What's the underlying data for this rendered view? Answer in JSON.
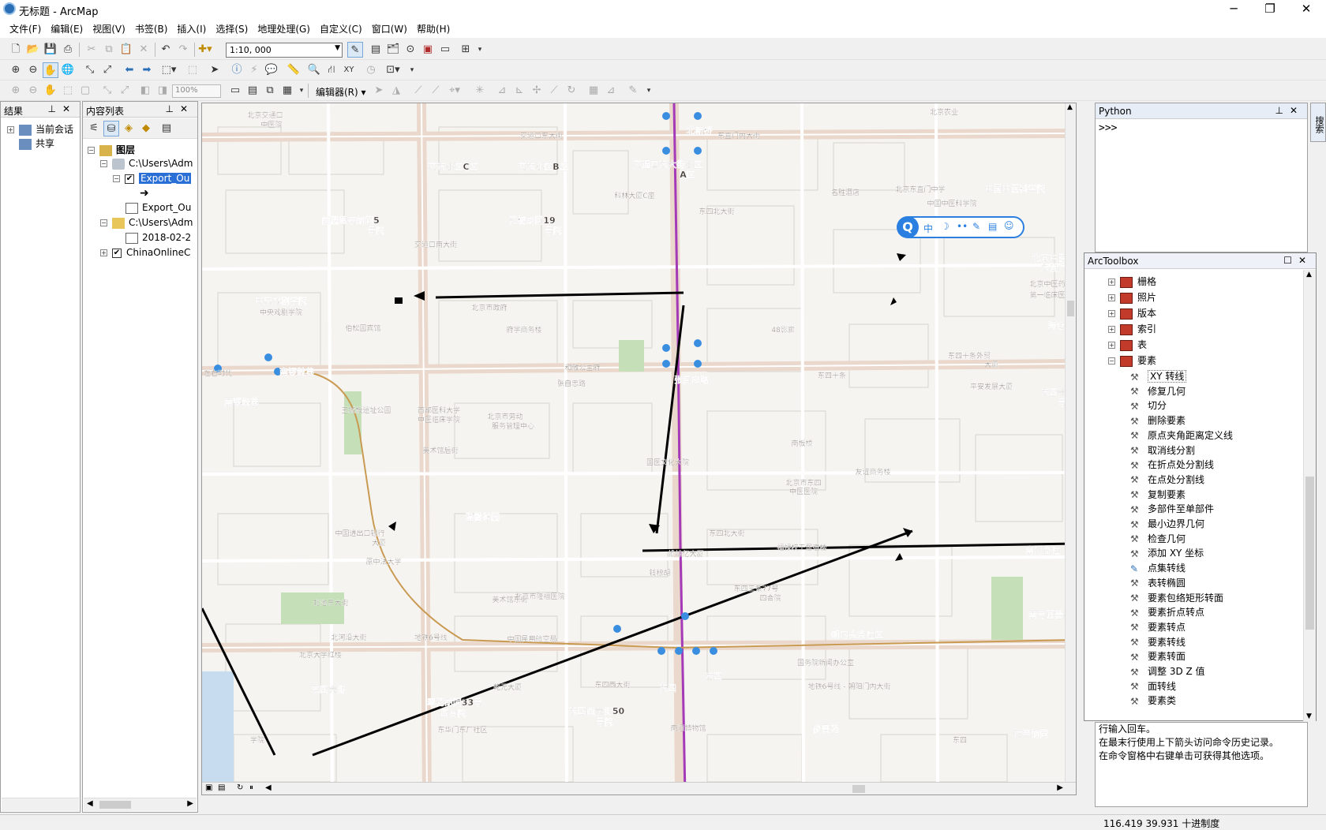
{
  "window": {
    "title": "无标题 - ArcMap",
    "minimize": "─",
    "restore": "❐",
    "close": "✕"
  },
  "menu": [
    "文件(F)",
    "编辑(E)",
    "视图(V)",
    "书签(B)",
    "插入(I)",
    "选择(S)",
    "地理处理(G)",
    "自定义(C)",
    "窗口(W)",
    "帮助(H)"
  ],
  "toolbar": {
    "scale": "1:10, 000",
    "zoom_percent": "100%",
    "editor_label": "编辑器(R)"
  },
  "results_panel": {
    "title": "结果",
    "items": [
      "当前会话",
      "共享"
    ]
  },
  "toc_panel": {
    "title": "内容列表",
    "layers_root": "图层",
    "items": [
      "C:\\Users\\Adm",
      "Export_Ou",
      "Export_Ou",
      "C:\\Users\\Adm",
      "2018-02-2",
      "ChinaOnlineC"
    ]
  },
  "map": {
    "labels": [
      {
        "text": "北京交通口",
        "cls": "s"
      },
      {
        "text": "中医院",
        "cls": "s"
      },
      {
        "text": "北新桥",
        "cls": "b"
      },
      {
        "text": "东直门内大街",
        "cls": "s"
      },
      {
        "text": "交道口东大街",
        "cls": "s"
      },
      {
        "text": "交东小区C区",
        "cls": "b"
      },
      {
        "text": "交东小区B区",
        "cls": "b"
      },
      {
        "text": "交通口东大街小区",
        "cls": "b"
      },
      {
        "text": "A区",
        "cls": "b"
      },
      {
        "text": "科林大厦C座",
        "cls": "s"
      },
      {
        "text": "北京东直门中学",
        "cls": "s"
      },
      {
        "text": "中国中医科学院",
        "cls": "b"
      },
      {
        "text": "中国中医科学院",
        "cls": "s"
      },
      {
        "text": "名胜酒店",
        "cls": "s"
      },
      {
        "text": "前圆恩寺胡同5",
        "cls": "b"
      },
      {
        "text": "号院",
        "cls": "b"
      },
      {
        "text": "花梗胡同19",
        "cls": "b"
      },
      {
        "text": "号院",
        "cls": "b"
      },
      {
        "text": "东四北大街",
        "cls": "s"
      },
      {
        "text": "交道口南大街",
        "cls": "s"
      },
      {
        "text": "北京中医药大学",
        "cls": "b"
      },
      {
        "text": "东直门医院",
        "cls": "b"
      },
      {
        "text": "北京中医药大学",
        "cls": "s"
      },
      {
        "text": "第一临床医学院",
        "cls": "s"
      },
      {
        "text": "中央戏剧学院",
        "cls": "b"
      },
      {
        "text": "中央戏剧学院",
        "cls": "s"
      },
      {
        "text": "北京市政府",
        "cls": "s"
      },
      {
        "text": "府学商务楼",
        "cls": "s"
      },
      {
        "text": "伯松园宾馆",
        "cls": "s"
      },
      {
        "text": "48影廊",
        "cls": "s"
      },
      {
        "text": "海运",
        "cls": "b"
      },
      {
        "text": "东四十条外贸",
        "cls": "s"
      },
      {
        "text": "大厦",
        "cls": "s"
      },
      {
        "text": "左右时代",
        "cls": "s"
      },
      {
        "text": "南锣鼓巷",
        "cls": "b"
      },
      {
        "text": "和敬公主府",
        "cls": "s"
      },
      {
        "text": "张自忠路",
        "cls": "b"
      },
      {
        "text": "东四十条",
        "cls": "s"
      },
      {
        "text": "张自忠路",
        "cls": "s"
      },
      {
        "text": "平安发展大厦",
        "cls": "s"
      },
      {
        "text": "东四十条甲",
        "cls": "b"
      },
      {
        "text": "号院",
        "cls": "b"
      },
      {
        "text": "南锣鼓巷",
        "cls": "b"
      },
      {
        "text": "玉城板遗址公园",
        "cls": "s"
      },
      {
        "text": "首都医科大学",
        "cls": "s"
      },
      {
        "text": "中医临床学院",
        "cls": "s"
      },
      {
        "text": "北京市劳动",
        "cls": "s"
      },
      {
        "text": "服务管理中心",
        "cls": "s"
      },
      {
        "text": "南板桥",
        "cls": "s"
      },
      {
        "text": "美术馆后街",
        "cls": "s"
      },
      {
        "text": "国医文化大院",
        "cls": "s"
      },
      {
        "text": "友谊商务楼",
        "cls": "s"
      },
      {
        "text": "北京市东四",
        "cls": "s"
      },
      {
        "text": "中医医院",
        "cls": "s"
      },
      {
        "text": "温馨家园",
        "cls": "b"
      },
      {
        "text": "中国进出口银行",
        "cls": "s"
      },
      {
        "text": "大厦",
        "cls": "s"
      },
      {
        "text": "东四北大街",
        "cls": "s"
      },
      {
        "text": "蟾蜍亿大厦",
        "cls": "s"
      },
      {
        "text": "福禄校干居宿楼",
        "cls": "s"
      },
      {
        "text": "南门仓社",
        "cls": "b"
      },
      {
        "text": "原中法大学",
        "cls": "s"
      },
      {
        "text": "钱粮胡",
        "cls": "s"
      },
      {
        "text": "东四三条77号",
        "cls": "s"
      },
      {
        "text": "四合院",
        "cls": "s"
      },
      {
        "text": "北京市隆福医院",
        "cls": "s"
      },
      {
        "text": "美术馆东街",
        "cls": "s"
      },
      {
        "text": "南弓匠营小区",
        "cls": "b"
      },
      {
        "text": "地铁6号线",
        "cls": "s"
      },
      {
        "text": "朝内头条社区",
        "cls": "b"
      },
      {
        "text": "北京大学红楼",
        "cls": "s"
      },
      {
        "text": "中国民用航空局",
        "cls": "s"
      },
      {
        "text": "国务院新闻办公室",
        "cls": "s"
      },
      {
        "text": "东四",
        "cls": "b"
      },
      {
        "text": "五四大街",
        "cls": "b"
      },
      {
        "text": "东四西大街",
        "cls": "s"
      },
      {
        "text": "东四",
        "cls": "b"
      },
      {
        "text": "地铁6号线 - 朝阳门内大街",
        "cls": "s"
      },
      {
        "text": "翠花胡同33号",
        "cls": "b"
      },
      {
        "text": "四合院",
        "cls": "b"
      },
      {
        "text": "东四西大街50",
        "cls": "b"
      },
      {
        "text": "号院",
        "cls": "b"
      },
      {
        "text": "东华门东厂社区",
        "cls": "s"
      },
      {
        "text": "俊景苑",
        "cls": "b"
      },
      {
        "text": "竹竿胡同",
        "cls": "b"
      },
      {
        "text": "北河沿大街",
        "cls": "s"
      },
      {
        "text": "北池子大街",
        "cls": "s"
      },
      {
        "text": "学院",
        "cls": "s"
      },
      {
        "text": "南恒博物馆",
        "cls": "s"
      },
      {
        "text": "东四",
        "cls": "s"
      },
      {
        "text": "北京农业",
        "cls": "s"
      },
      {
        "text": "乾元大厦",
        "cls": "s"
      }
    ],
    "float_toolbar": [
      "中",
      "☽",
      "••",
      "✎",
      "▤",
      "☺"
    ]
  },
  "python_panel": {
    "title": "Python",
    "prompt": ">>>",
    "help_lines": [
      "行输入回车。",
      "在最末行使用上下箭头访问命令历史记录。",
      "在命令窗格中右键单击可获得其他选项。"
    ]
  },
  "side_tab": "搜索",
  "toolbox": {
    "title": "ArcToolbox",
    "categories": [
      "栅格",
      "照片",
      "版本",
      "索引",
      "表",
      "要素"
    ],
    "tools": [
      "XY 转线",
      "修复几何",
      "切分",
      "删除要素",
      "原点夹角距离定义线",
      "取消线分割",
      "在折点处分割线",
      "在点处分割线",
      "复制要素",
      "多部件至单部件",
      "最小边界几何",
      "检查几何",
      "添加 XY 坐标",
      "点集转线",
      "表转椭圆",
      "要素包络矩形转面",
      "要素折点转点",
      "要素转点",
      "要素转线",
      "要素转面",
      "调整 3D Z 值",
      "面转线",
      "要素类"
    ]
  },
  "status": {
    "coords": "116.419  39.931 十进制度"
  }
}
